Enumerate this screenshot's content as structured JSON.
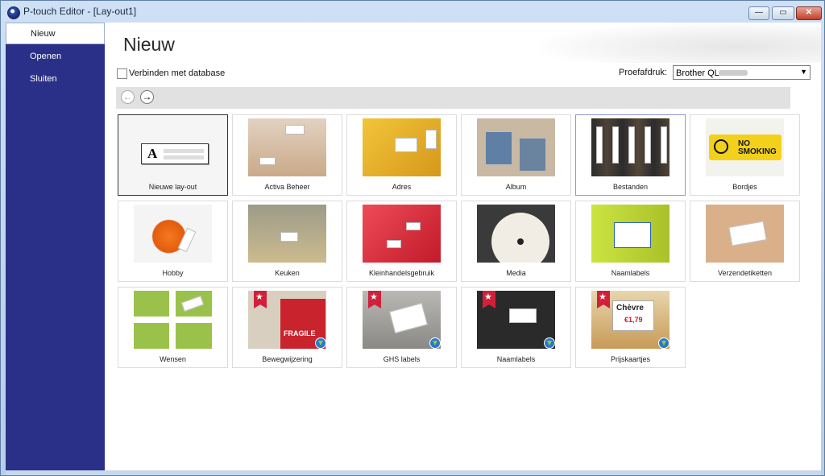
{
  "window": {
    "title": "P-touch Editor - [Lay-out1]"
  },
  "sidebar": {
    "items": [
      {
        "label": "Nieuw",
        "active": true
      },
      {
        "label": "Openen",
        "active": false
      },
      {
        "label": "Sluiten",
        "active": false
      }
    ]
  },
  "page": {
    "title": "Nieuw"
  },
  "options": {
    "connect_db_label": "Verbinden met database",
    "connect_db_checked": false,
    "proof_label": "Proefafdruk:",
    "printer_value": "Brother QL"
  },
  "icons": {
    "back": "arrow-left-icon",
    "forward": "arrow-right-icon",
    "download": "download-icon",
    "ribbon": "star-ribbon-icon"
  },
  "templates": [
    {
      "label": "Nieuwe lay-out"
    },
    {
      "label": "Activa Beheer"
    },
    {
      "label": "Adres"
    },
    {
      "label": "Album"
    },
    {
      "label": "Bestanden"
    },
    {
      "label": "Bordjes",
      "sign_text_1": "NO",
      "sign_text_2": "SMOKING"
    },
    {
      "label": "Hobby"
    },
    {
      "label": "Keuken"
    },
    {
      "label": "Kleinhandelsgebruik"
    },
    {
      "label": "Media"
    },
    {
      "label": "Naamlabels"
    },
    {
      "label": "Verzendetiketten"
    },
    {
      "label": "Wensen"
    },
    {
      "label": "Bewegwijzering",
      "badge_text": "FRAGILE"
    },
    {
      "label": "GHS labels"
    },
    {
      "label": "Naamlabels"
    },
    {
      "label": "Prijskaartjes",
      "tag_text": "Chèvre",
      "price_text": "€1,79"
    }
  ],
  "colors": {
    "sidebar": "#2a2f87",
    "accent_ribbon": "#d2203a"
  }
}
